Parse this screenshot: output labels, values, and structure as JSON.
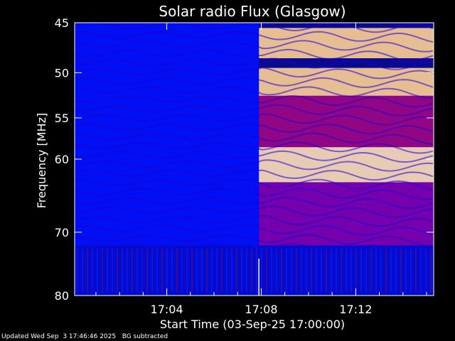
{
  "chart_data": {
    "type": "heatmap",
    "title": "Solar radio Flux (Glasgow)",
    "xlabel": "Start Time (03-Sep-25 17:00:00)",
    "ylabel": "Frequency [MHz]",
    "x_unit": "minutes after 17:00:00",
    "xlim": [
      0.1,
      15.3
    ],
    "ylim": [
      80,
      45
    ],
    "x_ticks": [
      {
        "value": 4,
        "label": "17:04"
      },
      {
        "value": 8,
        "label": "17:08"
      },
      {
        "value": 12,
        "label": "17:12"
      }
    ],
    "y_ticks": [
      {
        "value": 45,
        "label": "45"
      },
      {
        "value": 50,
        "label": "50"
      },
      {
        "value": 55,
        "label": "55"
      },
      {
        "value": 60,
        "label": "60"
      },
      {
        "value": 70,
        "label": "70"
      },
      {
        "value": 80,
        "label": "80"
      }
    ],
    "colormap": [
      "#000060",
      "#0010ff",
      "#8000b0",
      "#ff1500",
      "#ffc070",
      "#ffffff"
    ],
    "burst_onset_minute": 7.9,
    "intensity_bands": [
      {
        "freq_min": 45.5,
        "freq_max": 48.5,
        "t_start": 7.9,
        "t_end": 15.3,
        "level": 0.85
      },
      {
        "freq_min": 49.5,
        "freq_max": 52.5,
        "t_start": 7.9,
        "t_end": 15.3,
        "level": 0.85
      },
      {
        "freq_min": 58.5,
        "freq_max": 63.0,
        "t_start": 7.9,
        "t_end": 15.3,
        "level": 0.9
      },
      {
        "freq_min": 52.5,
        "freq_max": 58.5,
        "t_start": 7.9,
        "t_end": 15.3,
        "level": 0.45
      },
      {
        "freq_min": 63.0,
        "freq_max": 72.0,
        "t_start": 7.9,
        "t_end": 15.3,
        "level": 0.4
      },
      {
        "freq_min": 45.0,
        "freq_max": 72.0,
        "t_start": 0.1,
        "t_end": 7.9,
        "level": 0.2
      },
      {
        "freq_min": 72.0,
        "freq_max": 80.0,
        "t_start": 0.1,
        "t_end": 15.3,
        "level": 0.15
      }
    ],
    "footer": "Updated Wed Sep  3 17:46:46 2025   BG subtracted"
  },
  "colors": {
    "background": "#000000",
    "axis": "#ffffff",
    "text": "#ffffff"
  }
}
